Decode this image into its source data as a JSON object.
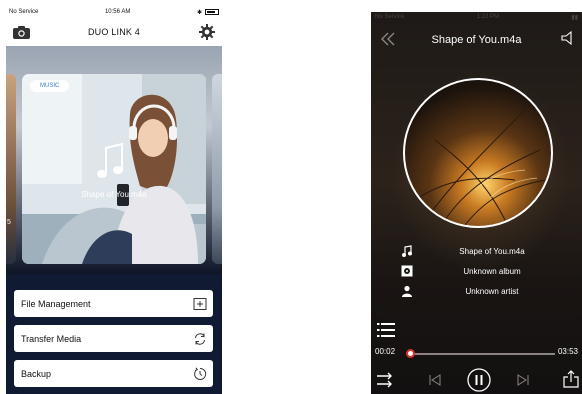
{
  "left_screen": {
    "status": {
      "carrier": "No Service",
      "time": "10:56 AM"
    },
    "header": {
      "title": "DUO LINK 4"
    },
    "carousel": {
      "badge": "MUSIC",
      "caption": "Shape of You.m4a",
      "side_label": "5"
    },
    "menu": [
      {
        "label": "File Management",
        "icon": "add-folder-icon"
      },
      {
        "label": "Transfer Media",
        "icon": "sync-icon"
      },
      {
        "label": "Backup",
        "icon": "backup-timer-icon"
      }
    ]
  },
  "right_screen": {
    "status": {
      "carrier": "No Service",
      "time": "1:22 PM"
    },
    "header": {
      "title": "Shape of You.m4a"
    },
    "info": {
      "song": "Shape of You.m4a",
      "album": "Unknown album",
      "artist": "Unknown artist"
    },
    "playback": {
      "current_time": "00:02",
      "total_time": "03:53",
      "progress_fraction": 0.01
    },
    "colors": {
      "thumb_ring": "#d9342b",
      "accent_bg": "#101a33"
    }
  }
}
